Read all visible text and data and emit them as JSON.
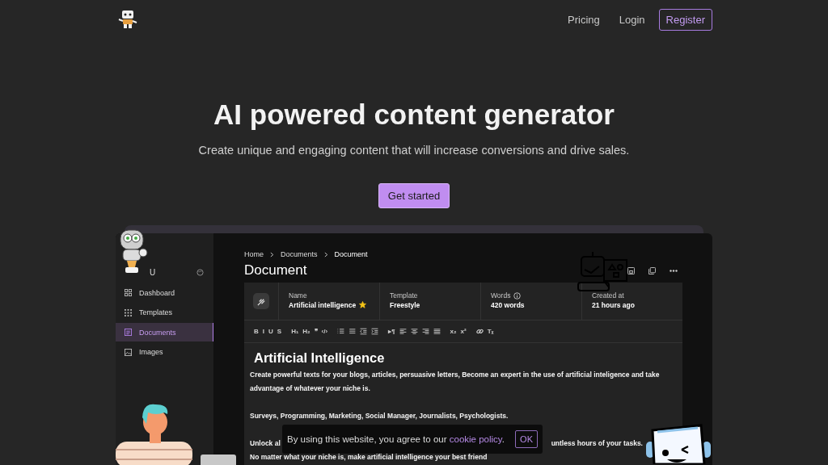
{
  "nav": {
    "links": [
      "Pricing",
      "Login"
    ],
    "register": "Register"
  },
  "hero": {
    "title": "AI powered content generator",
    "subtitle": "Create unique and engaging content that will increase conversions and drive sales.",
    "cta": "Get started"
  },
  "app": {
    "sidebar": {
      "user": "U",
      "items": [
        {
          "label": "Dashboard",
          "selected": false
        },
        {
          "label": "Templates",
          "selected": false
        },
        {
          "label": "Documents",
          "selected": true
        },
        {
          "label": "Images",
          "selected": false
        }
      ]
    },
    "breadcrumb": [
      "Home",
      "Documents",
      "Document"
    ],
    "title": "Document",
    "info": [
      {
        "label": "Name",
        "value": "Artificial intelligence",
        "favorite": true
      },
      {
        "label": "Template",
        "value": "Freestyle"
      },
      {
        "label": "Words",
        "value": "420 words",
        "info": true
      },
      {
        "label": "Created at",
        "value": "21 hours ago"
      }
    ],
    "toolbar": [
      [
        {
          "kind": "text",
          "label": "B"
        },
        {
          "kind": "text",
          "label": "I"
        },
        {
          "kind": "text",
          "label": "U"
        },
        {
          "kind": "text",
          "label": "S"
        }
      ],
      [
        {
          "kind": "text",
          "label": "H₁"
        },
        {
          "kind": "text",
          "label": "H₂"
        },
        {
          "kind": "text",
          "label": "❞"
        },
        {
          "kind": "text",
          "label": "‹/›"
        }
      ],
      [
        {
          "kind": "ordered-list"
        },
        {
          "kind": "bullet-list"
        },
        {
          "kind": "outdent"
        },
        {
          "kind": "indent"
        }
      ],
      [
        {
          "kind": "text",
          "label": "▸¶"
        },
        {
          "kind": "align-left"
        },
        {
          "kind": "align-center"
        },
        {
          "kind": "align-right"
        },
        {
          "kind": "justify"
        }
      ],
      [
        {
          "kind": "text",
          "label": "x₂"
        },
        {
          "kind": "text",
          "label": "x²"
        }
      ],
      [
        {
          "kind": "link"
        },
        {
          "kind": "text",
          "label": "Tₓ"
        }
      ]
    ],
    "editor": {
      "heading": "Artificial Intelligence",
      "blocks": [
        [
          {
            "kind": "plain",
            "text": "Create powerful texts for your blogs, articles, persuasive letters, Become an expert in the use of artificial inteligence and take advantage of whatever your niche is."
          }
        ],
        [
          {
            "kind": "plain",
            "text": "Surveys, Programming, Marketing, Social Manager, Journalists, Psychologists."
          }
        ],
        [
          {
            "kind": "covered",
            "left": "Unlock al",
            "right": "untless hours of your tasks."
          },
          {
            "kind": "plain",
            "text": "No matter what your niche is, make artificial intelligence your best friend"
          }
        ]
      ]
    }
  },
  "cookie": {
    "text": "By using this website, you agree to our",
    "link": "cookie policy",
    "after": ".",
    "ok": "OK"
  }
}
